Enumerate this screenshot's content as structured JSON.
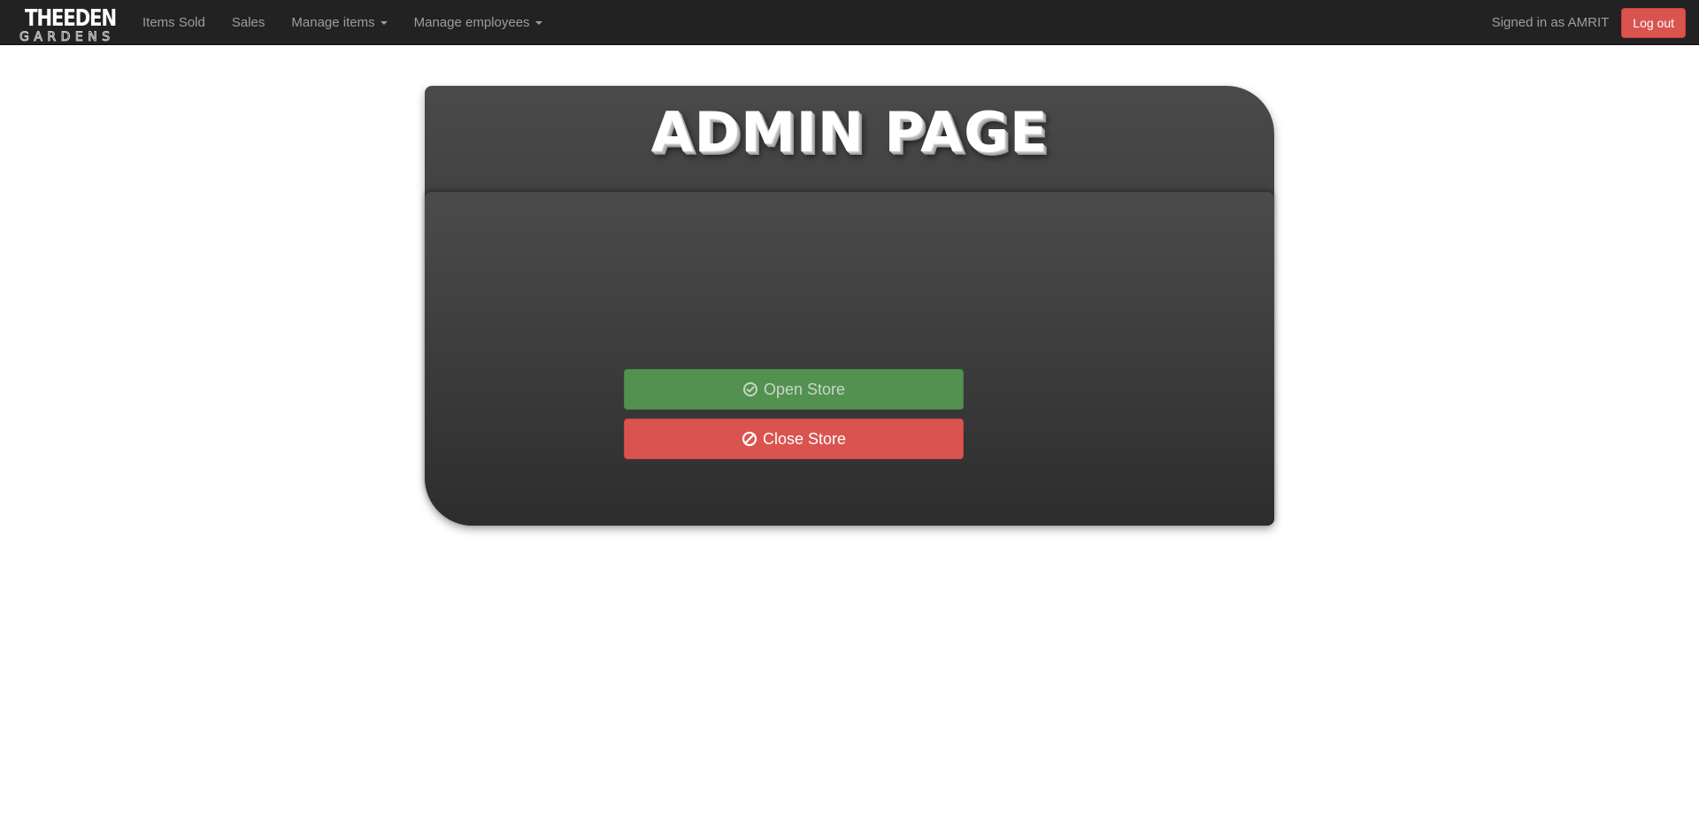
{
  "navbar": {
    "brand": {
      "line1": "THEEDEN",
      "line2": "GARDENS"
    },
    "links": [
      {
        "label": "Items Sold",
        "dropdown": false
      },
      {
        "label": "Sales",
        "dropdown": false
      },
      {
        "label": "Manage items",
        "dropdown": true
      },
      {
        "label": "Manage employees",
        "dropdown": true
      }
    ],
    "signed_in_text": "Signed in as AMRIT",
    "logout_label": "Log out"
  },
  "admin": {
    "title": "ADMIN PAGE",
    "open_store": {
      "label": "Open Store",
      "icon": "check-circle-icon"
    },
    "close_store": {
      "label": "Close Store",
      "icon": "ban-icon"
    }
  },
  "colors": {
    "navbar_bg": "#222222",
    "nav_text": "#9d9d9d",
    "danger": "#d9534f",
    "success": "#539150",
    "panel_dark": "#2d2d2d"
  }
}
